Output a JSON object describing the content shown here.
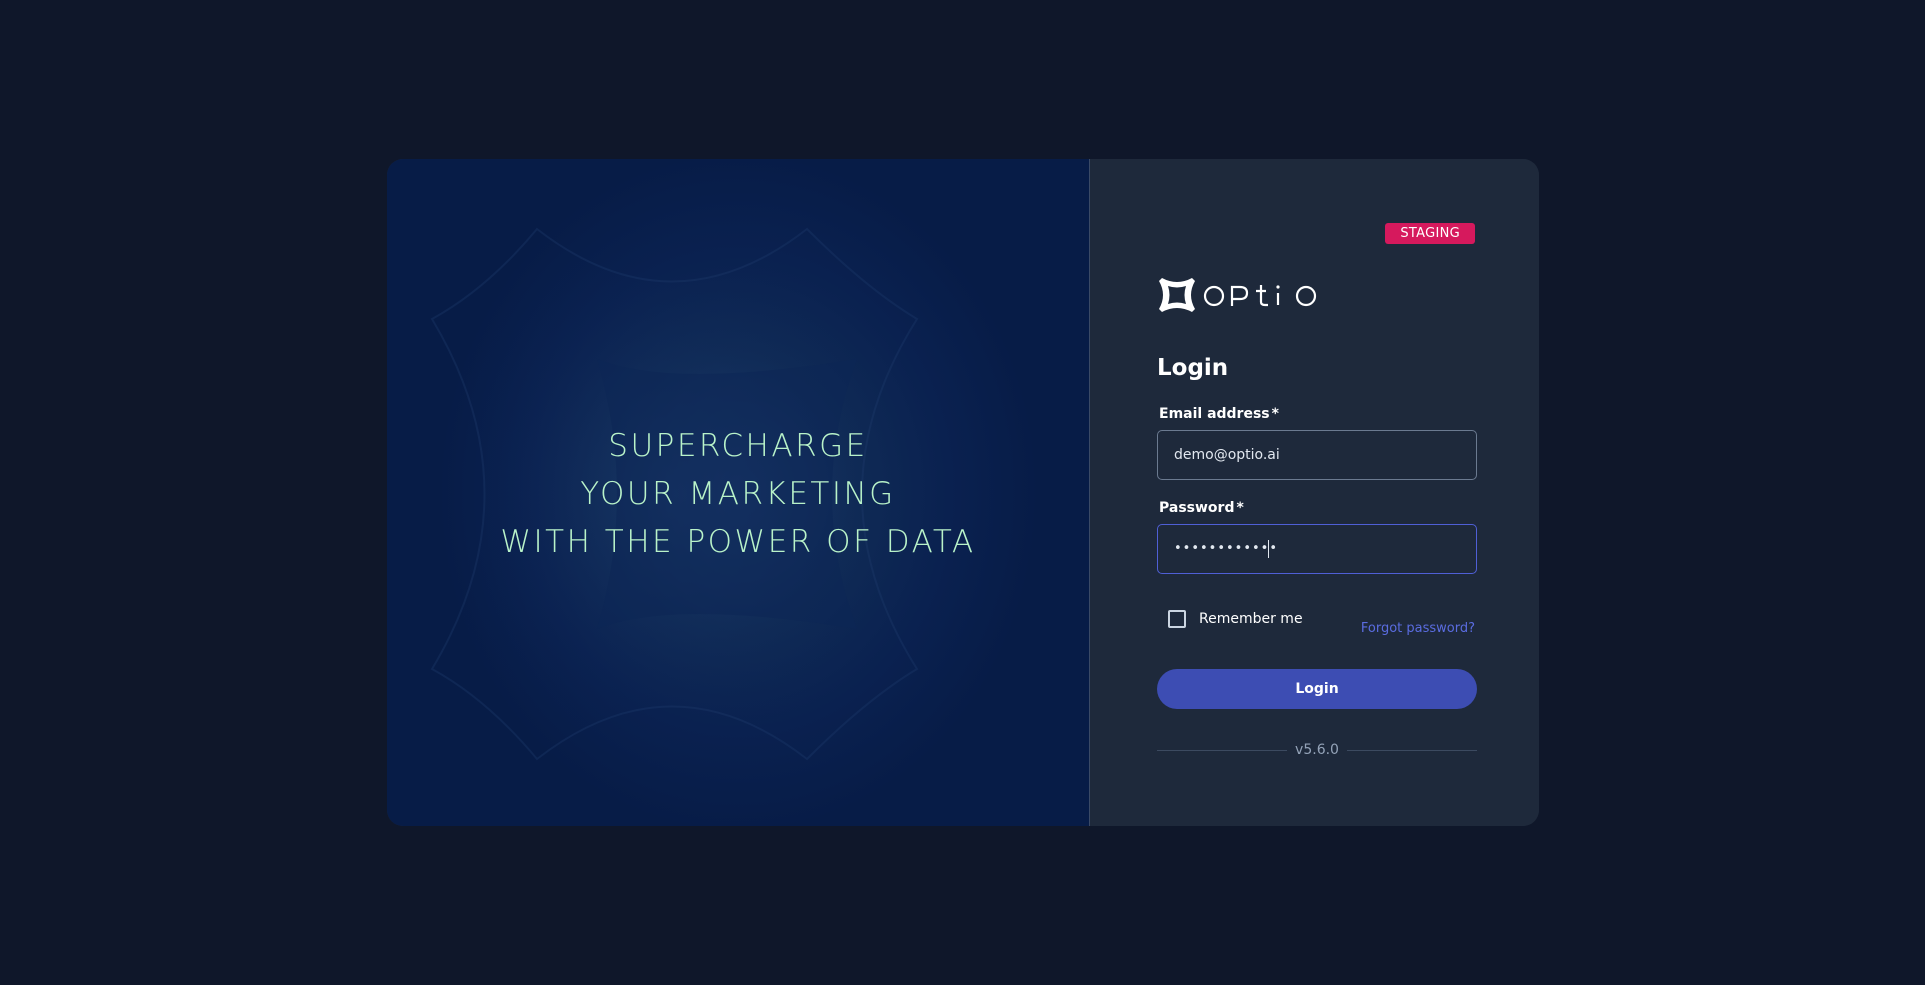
{
  "hero": {
    "lines": [
      "SUPERCHARGE",
      "YOUR MARKETING",
      "WITH THE POWER OF DATA"
    ]
  },
  "badge": {
    "label": "STAGING",
    "color": "#d6195d"
  },
  "logo": {
    "wordmark": "OPtiO",
    "alt": "optio"
  },
  "form": {
    "title": "Login",
    "email": {
      "label": "Email address",
      "required_mark": "*",
      "value": "demo@optio.ai"
    },
    "password": {
      "label": "Password",
      "required_mark": "*",
      "masked_value": "••••••••••••"
    },
    "remember_label": "Remember me",
    "remember_checked": false,
    "forgot_label": "Forgot password?",
    "submit_label": "Login"
  },
  "version": "v5.6.0",
  "colors": {
    "background": "#0f172a",
    "panel": "#1e293b",
    "accent": "#3d4db3",
    "link": "#5a6ce0",
    "hero_text": "#b9f3c9"
  }
}
